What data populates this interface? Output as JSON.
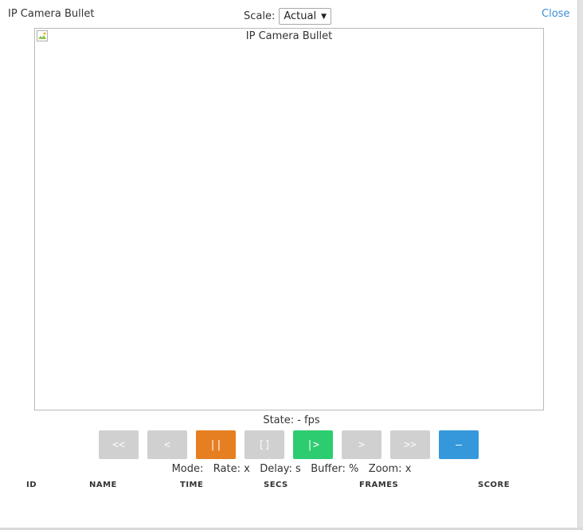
{
  "window": {
    "title": "IP Camera Bullet",
    "close_label": "Close"
  },
  "scale": {
    "label": "Scale:",
    "selected": "Actual"
  },
  "viewer": {
    "image_alt": "IP Camera Bullet"
  },
  "state_line": "State:  -  fps",
  "controls": [
    {
      "label": "<<",
      "state": "disabled"
    },
    {
      "label": "<",
      "state": "disabled"
    },
    {
      "label": "||",
      "state": "active",
      "color": "#e67e22"
    },
    {
      "label": "[]",
      "state": "disabled"
    },
    {
      "label": "|>",
      "state": "active",
      "color": "#2ecc71"
    },
    {
      "label": ">",
      "state": "disabled"
    },
    {
      "label": ">>",
      "state": "disabled"
    },
    {
      "label": "–",
      "state": "active",
      "color": "#3498db"
    }
  ],
  "status_line": "Mode:   Rate: x   Delay: s   Buffer: %   Zoom: x",
  "table": {
    "headers": [
      "ID",
      "NAME",
      "TIME",
      "SECS",
      "FRAMES",
      "SCORE"
    ]
  }
}
